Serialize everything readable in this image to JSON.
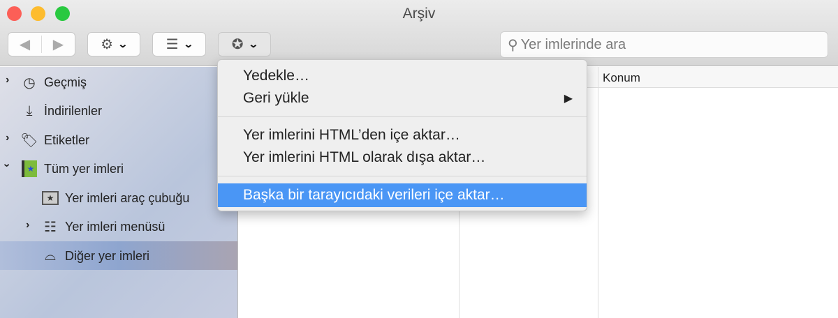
{
  "window": {
    "title": "Arşiv"
  },
  "toolbar": {
    "back": "◀",
    "forward": "▶",
    "organize": "gear-icon",
    "views": "list-icon",
    "import_backup": "star-icon"
  },
  "search": {
    "placeholder": "Yer imlerinde ara"
  },
  "sidebar": {
    "items": [
      {
        "label": "Geçmiş"
      },
      {
        "label": "İndirilenler"
      },
      {
        "label": "Etiketler"
      },
      {
        "label": "Tüm yer imleri"
      },
      {
        "label": "Yer imleri araç çubuğu"
      },
      {
        "label": "Yer imleri menüsü"
      },
      {
        "label": "Diğer yer imleri"
      }
    ]
  },
  "table": {
    "columns": [
      "Konum"
    ]
  },
  "menu": {
    "items": [
      {
        "label": "Yedekle…"
      },
      {
        "label": "Geri yükle"
      },
      {
        "label": "Yer imlerini HTML’den içe aktar…"
      },
      {
        "label": "Yer imlerini HTML olarak dışa aktar…"
      },
      {
        "label": "Başka bir tarayıcıdaki verileri içe aktar…"
      }
    ]
  },
  "colors": {
    "highlight": "#4a96f5",
    "selection": "#8ea5cf"
  }
}
